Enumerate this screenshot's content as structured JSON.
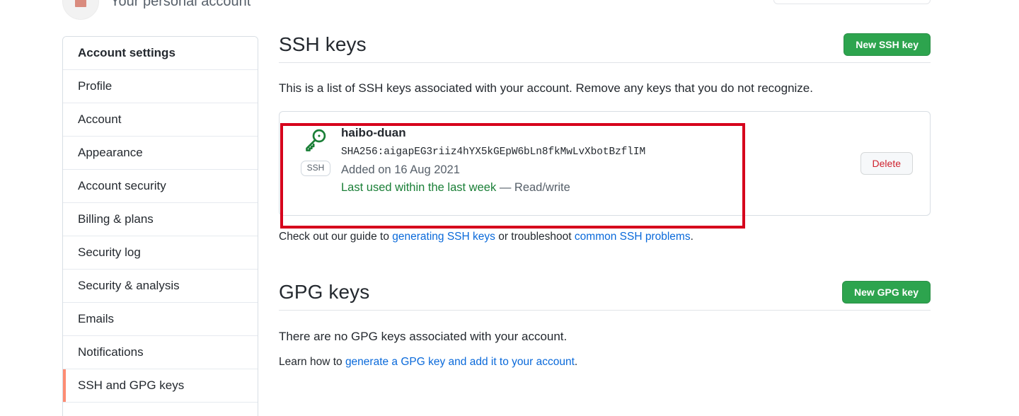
{
  "account_header": {
    "subtitle": "Your personal account",
    "avatar_name": "user-avatar"
  },
  "sidebar": {
    "items": [
      {
        "label": "Account settings",
        "active": false,
        "is_header": true
      },
      {
        "label": "Profile",
        "active": false,
        "is_header": false
      },
      {
        "label": "Account",
        "active": false,
        "is_header": false
      },
      {
        "label": "Appearance",
        "active": false,
        "is_header": false
      },
      {
        "label": "Account security",
        "active": false,
        "is_header": false
      },
      {
        "label": "Billing & plans",
        "active": false,
        "is_header": false
      },
      {
        "label": "Security log",
        "active": false,
        "is_header": false
      },
      {
        "label": "Security & analysis",
        "active": false,
        "is_header": false
      },
      {
        "label": "Emails",
        "active": false,
        "is_header": false
      },
      {
        "label": "Notifications",
        "active": false,
        "is_header": false
      },
      {
        "label": "SSH and GPG keys",
        "active": true,
        "is_header": false
      }
    ]
  },
  "ssh_section": {
    "title": "SSH keys",
    "new_key_button": "New SSH key",
    "description": "This is a list of SSH keys associated with your account. Remove any keys that you do not recognize.",
    "key": {
      "badge": "SSH",
      "title": "haibo-duan",
      "fingerprint": "SHA256:aigapEG3riiz4hYX5kGEpW6bLn8fkMwLvXbotBzflIM",
      "added": "Added on 16 Aug 2021",
      "last_used": "Last used within the last week",
      "access": "— Read/write",
      "delete_button": "Delete"
    },
    "guide": {
      "prefix": "Check out our guide to ",
      "link1": "generating SSH keys",
      "middle": " or troubleshoot ",
      "link2": "common SSH problems",
      "suffix": "."
    }
  },
  "gpg_section": {
    "title": "GPG keys",
    "new_key_button": "New GPG key",
    "empty_message": "There are no GPG keys associated with your account.",
    "learn": {
      "prefix": "Learn how to ",
      "link": "generate a GPG key and add it to your account",
      "suffix": "."
    }
  },
  "colors": {
    "green_button": "#2da44e",
    "link": "#0969da",
    "delete_text": "#cf222e",
    "active_marker": "#fd8c73",
    "key_icon": "#1a7f37",
    "last_used": "#1a7f37",
    "annotation": "#d6001c"
  }
}
